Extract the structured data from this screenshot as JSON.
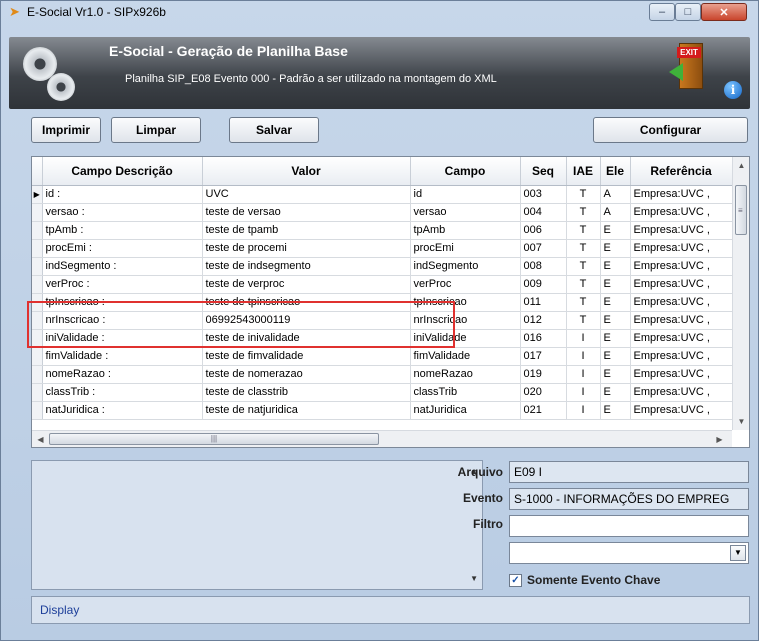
{
  "window": {
    "title": "E-Social Vr1.0 - SIPx926b",
    "controls": [
      "–",
      "□",
      "✕"
    ]
  },
  "header": {
    "title": "E-Social - Geração de Planilha Base",
    "subtitle": "Planilha SIP_E08 Evento 000 - Padrão a ser utilizado na montagem do XML",
    "exit_sign": "EXIT",
    "info": "i"
  },
  "toolbar": {
    "print_label": "Imprimir",
    "clear_label": "Limpar",
    "save_label": "Salvar",
    "configure_label": "Configurar"
  },
  "grid": {
    "columns": [
      "Campo Descrição",
      "Valor",
      "Campo",
      "Seq",
      "IAE",
      "Ele",
      "Referência"
    ],
    "rows": [
      {
        "desc": "id :",
        "valor": "UVC",
        "campo": "id",
        "seq": "003",
        "iae": "T",
        "ele": "A",
        "ref": "Empresa:UVC , "
      },
      {
        "desc": "versao :",
        "valor": "teste de versao",
        "campo": "versao",
        "seq": "004",
        "iae": "T",
        "ele": "A",
        "ref": "Empresa:UVC , "
      },
      {
        "desc": "tpAmb :",
        "valor": "teste de tpamb",
        "campo": "tpAmb",
        "seq": "006",
        "iae": "T",
        "ele": "E",
        "ref": "Empresa:UVC , "
      },
      {
        "desc": "procEmi :",
        "valor": "teste de procemi",
        "campo": "procEmi",
        "seq": "007",
        "iae": "T",
        "ele": "E",
        "ref": "Empresa:UVC , "
      },
      {
        "desc": "indSegmento :",
        "valor": "teste de indsegmento",
        "campo": "indSegmento",
        "seq": "008",
        "iae": "T",
        "ele": "E",
        "ref": "Empresa:UVC , "
      },
      {
        "desc": "verProc :",
        "valor": "teste de verproc",
        "campo": "verProc",
        "seq": "009",
        "iae": "T",
        "ele": "E",
        "ref": "Empresa:UVC , "
      },
      {
        "desc": "tpInscricao :",
        "valor": "teste de tpinscricao",
        "campo": "tpInscricao",
        "seq": "011",
        "iae": "T",
        "ele": "E",
        "ref": "Empresa:UVC , "
      },
      {
        "desc": "nrInscricao :",
        "valor": "06992543000119",
        "campo": "nrInscricao",
        "seq": "012",
        "iae": "T",
        "ele": "E",
        "ref": "Empresa:UVC , "
      },
      {
        "desc": "iniValidade :",
        "valor": "teste de inivalidade",
        "campo": "iniValidade",
        "seq": "016",
        "iae": "I",
        "ele": "E",
        "ref": "Empresa:UVC , "
      },
      {
        "desc": "fimValidade :",
        "valor": "teste de fimvalidade",
        "campo": "fimValidade",
        "seq": "017",
        "iae": "I",
        "ele": "E",
        "ref": "Empresa:UVC , "
      },
      {
        "desc": "nomeRazao :",
        "valor": "teste de nomerazao",
        "campo": "nomeRazao",
        "seq": "019",
        "iae": "I",
        "ele": "E",
        "ref": "Empresa:UVC , "
      },
      {
        "desc": "classTrib :",
        "valor": "teste de classtrib",
        "campo": "classTrib",
        "seq": "020",
        "iae": "I",
        "ele": "E",
        "ref": "Empresa:UVC , "
      },
      {
        "desc": "natJuridica :",
        "valor": "teste de natjuridica",
        "campo": "natJuridica",
        "seq": "021",
        "iae": "I",
        "ele": "E",
        "ref": "Empresa:UVC , "
      }
    ]
  },
  "form": {
    "arquivo_label": "Arquivo",
    "arquivo_value": "E09 I",
    "evento_label": "Evento",
    "evento_value": "S-1000 - INFORMAÇÕES DO EMPREG",
    "filtro_label": "Filtro",
    "filtro_value": "",
    "select_value": "",
    "checkbox_label": "Somente Evento Chave",
    "checkbox_checked": true
  },
  "status": {
    "text": "Display"
  },
  "colors": {
    "highlight": "#e0312f",
    "status_text": "#1d3f9a"
  }
}
